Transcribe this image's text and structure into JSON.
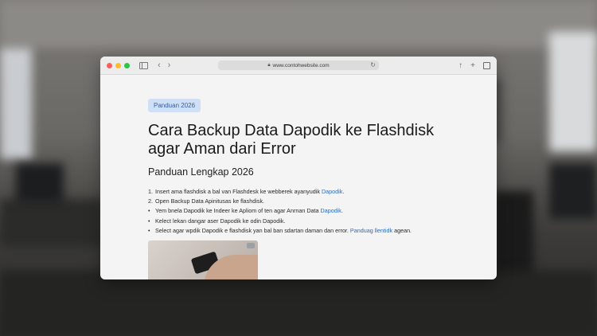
{
  "browser": {
    "url": "www.contohwebsite.com",
    "icons": [
      "sidebar-icon",
      "back-icon",
      "forward-icon",
      "lock-icon",
      "reload-icon",
      "share-icon",
      "new-tab-icon",
      "tabs-icon"
    ]
  },
  "article": {
    "tag": "Panduan 2026",
    "title_line1": "Cara Backup Data Dapodik ke Flashdisk",
    "title_line2": "agar Aman dari Error",
    "subtitle": "Panduan Lengkap 2026",
    "steps": [
      {
        "marker": "1.",
        "text": "Insert ama flashdisk a bal van Flashdesk ke webberek ayanyudik ",
        "link": "Dapodik",
        "tail": "."
      },
      {
        "marker": "2.",
        "text": "Open Backup Data Apinitusas ke flashdisk.",
        "link": "",
        "tail": ""
      },
      {
        "marker": "•",
        "text": "Yem bnela Dapodik ke Indeer ke Apliom of ten agar Anrnan Data ",
        "link": "Dapodik",
        "tail": "."
      },
      {
        "marker": "•",
        "text": "Kelect lekan dangar aser Dapodik ke odin Dapodik.",
        "link": "",
        "tail": ""
      },
      {
        "marker": "•",
        "text": "Select agar wpdik Dapodik e flashdisk yan bal ban sdartan daman dan error. ",
        "link": "Panduag llentidk",
        "tail": " agean."
      }
    ]
  },
  "colors": {
    "accent": "#2b6cc2",
    "tag_bg": "#cfe0f6",
    "tag_text": "#2f5fa4"
  }
}
